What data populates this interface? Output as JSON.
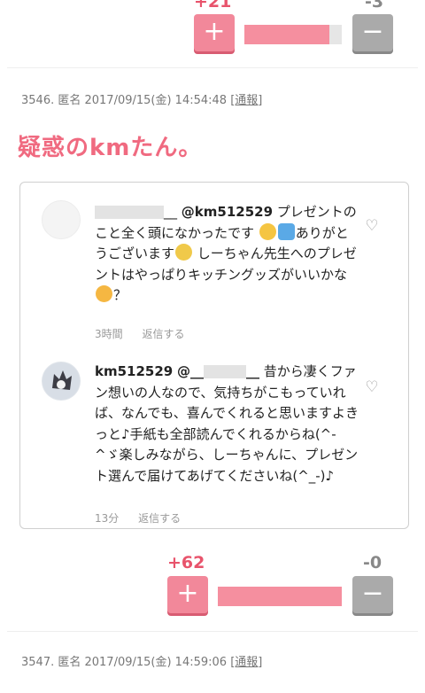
{
  "vote_top": {
    "plus_count": "+21",
    "minus_count": "-3",
    "plus_symbol": "+",
    "minus_symbol": "−",
    "plus_ratio": 0.875
  },
  "post": {
    "meta": "3546. 匿名 2017/09/15(金) 14:54:48",
    "report": "[通報]",
    "title": "疑惑のkmたん。",
    "comments": [
      {
        "user": "__",
        "mention": "@km512529",
        "text_a": " プレゼントのこと全く頭になかったです",
        "text_b": "ありがとうございます",
        "text_c": " しーちゃん先生へのプレゼントはやっぱりキッチングッズがいいかな",
        "text_d": "？",
        "time": "3時間",
        "reply": "返信する"
      },
      {
        "user": "km512529",
        "mention": "@__",
        "mention_end": "__",
        "text": " 昔から凄くファン想いの人なので、気持ちがこもっていれば、なんでも、喜んでくれると思いますよきっと♪手紙も全部読んでくれるからね(^-^ゞ楽しみながら、しーちゃんに、プレゼント選んで届けてあげてくださいね(^_-)♪",
        "time": "13分",
        "reply": "返信する"
      }
    ]
  },
  "vote_bottom": {
    "plus_count": "+62",
    "minus_count": "-0",
    "plus_symbol": "+",
    "minus_symbol": "−",
    "plus_ratio": 1.0
  },
  "next_post": {
    "meta": "3547. 匿名 2017/09/15(金) 14:59:06",
    "report": "[通報]"
  },
  "icons": {
    "heart": "♡"
  }
}
